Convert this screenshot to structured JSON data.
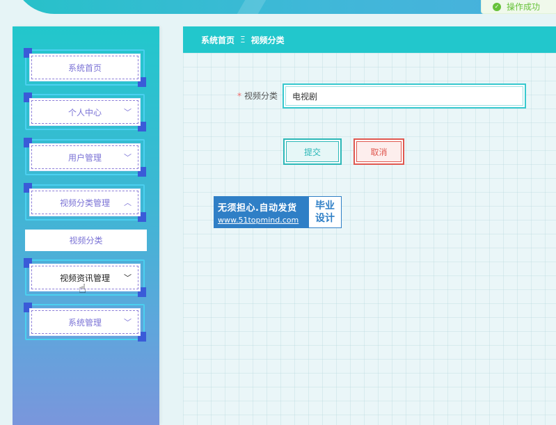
{
  "toast": {
    "text": "操作成功"
  },
  "sidebar": {
    "items": [
      {
        "label": "系统首页",
        "chevron": ""
      },
      {
        "label": "个人中心",
        "chevron": "﹀"
      },
      {
        "label": "用户管理",
        "chevron": "﹀"
      },
      {
        "label": "视频分类管理",
        "chevron": "︿"
      },
      {
        "label": "视频资讯管理",
        "chevron": "﹀"
      },
      {
        "label": "系统管理",
        "chevron": "﹀"
      }
    ],
    "submenu": {
      "label": "视频分类"
    }
  },
  "breadcrumb": {
    "home": "系统首页",
    "separator": "Ξ",
    "current": "视频分类"
  },
  "form": {
    "required_mark": "*",
    "category_label": "视频分类",
    "category_value": "电视剧",
    "submit_label": "提交",
    "cancel_label": "取消"
  },
  "watermark": {
    "line1": "无须担心.自动发货",
    "line2": "www.51topmind.com",
    "right_top": "毕业",
    "right_bottom": "设计"
  },
  "colors": {
    "primary": "#22c7cc",
    "submit": "#2bb7b7",
    "cancel": "#e0574f",
    "menu_text": "#7b73d6"
  }
}
